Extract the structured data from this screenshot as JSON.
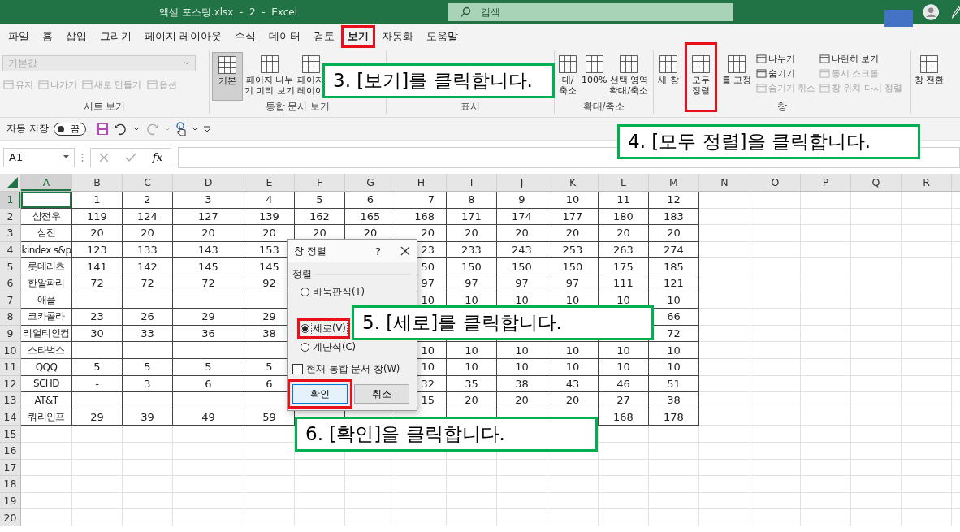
{
  "window": {
    "title": "엑셀 포스팅.xlsx  -  2  -  Excel"
  },
  "search": {
    "placeholder": "검색"
  },
  "tabs": [
    {
      "label": "파일",
      "selected": false
    },
    {
      "label": "홈",
      "selected": false
    },
    {
      "label": "삽입",
      "selected": false
    },
    {
      "label": "그리기",
      "selected": false
    },
    {
      "label": "페이지 레이아웃",
      "selected": false
    },
    {
      "label": "수식",
      "selected": false
    },
    {
      "label": "데이터",
      "selected": false
    },
    {
      "label": "검토",
      "selected": false
    },
    {
      "label": "보기",
      "selected": true
    },
    {
      "label": "자동화",
      "selected": false
    },
    {
      "label": "도움말",
      "selected": false
    }
  ],
  "ribbon": [
    {
      "label": "시트 보기",
      "items": [
        {
          "kind": "dropdown",
          "value": "기본값",
          "disabled": true
        },
        {
          "kind": "row",
          "items": [
            {
              "label": "유지",
              "disabled": true
            },
            {
              "label": "나가기",
              "disabled": true
            },
            {
              "label": "새로 만들기",
              "disabled": true
            },
            {
              "label": "옵션",
              "disabled": true
            }
          ]
        }
      ]
    },
    {
      "label": "통합 문서 보기",
      "items": [
        {
          "kind": "large",
          "label": "기본",
          "selected": true
        },
        {
          "kind": "large",
          "label": "페이지 나누\n기 미리 보기",
          "selected": false
        },
        {
          "kind": "large",
          "label": "페이지\n레이아",
          "selected": false
        }
      ]
    },
    {
      "label": "표시"
    },
    {
      "label": "확대/축소",
      "items": [
        {
          "kind": "large",
          "label": "대/\n축소",
          "selected": false
        },
        {
          "kind": "large",
          "label": "100%",
          "selected": false
        },
        {
          "kind": "large",
          "label": "선택 영역\n확대/축소",
          "selected": false
        }
      ]
    },
    {
      "label": "창",
      "items": [
        {
          "kind": "large",
          "label": "새 창",
          "selected": false
        },
        {
          "kind": "large",
          "label": "모두\n정렬",
          "selected": false
        },
        {
          "kind": "large",
          "label": "틀 고정",
          "selected": false
        },
        {
          "kind": "stack",
          "items": [
            {
              "label": "나누기",
              "disabled": false
            },
            {
              "label": "숨기기",
              "disabled": false
            },
            {
              "label": "숨기기 취소",
              "disabled": true
            }
          ]
        },
        {
          "kind": "stack",
          "items": [
            {
              "label": "나란히 보기",
              "disabled": false
            },
            {
              "label": "동시 스크롤",
              "disabled": true
            },
            {
              "label": "창 위치 다시 정렬",
              "disabled": true
            }
          ]
        }
      ]
    },
    {
      "items": [
        {
          "kind": "large",
          "label": "창 전환",
          "selected": false
        }
      ]
    }
  ],
  "quick_access": {
    "autosave_label": "자동 저장",
    "autosave": {
      "on": false,
      "label": "끔"
    }
  },
  "formula_bar": {
    "name_box": "A1",
    "function_label": "fx"
  },
  "sheet": {
    "columns": [
      {
        "label": "A",
        "selected": true
      },
      {
        "label": "B",
        "selected": false
      },
      {
        "label": "C",
        "selected": false
      },
      {
        "label": "D",
        "selected": false
      },
      {
        "label": "E",
        "selected": false
      },
      {
        "label": "F",
        "selected": false
      },
      {
        "label": "G",
        "selected": false
      },
      {
        "label": "H",
        "selected": false
      },
      {
        "label": "I",
        "selected": false
      },
      {
        "label": "J",
        "selected": false
      },
      {
        "label": "K",
        "selected": false
      },
      {
        "label": "L",
        "selected": false
      },
      {
        "label": "M",
        "selected": false
      },
      {
        "label": "N",
        "selected": false
      },
      {
        "label": "O",
        "selected": false
      },
      {
        "label": "P",
        "selected": false
      },
      {
        "label": "Q",
        "selected": false
      },
      {
        "label": "R",
        "selected": false
      }
    ],
    "rows": [
      {
        "number": "1",
        "selected": true,
        "cells": [
          null,
          "1",
          "2",
          "3",
          "4",
          "5",
          "6",
          "7",
          "8",
          "9",
          "10",
          "11",
          "12"
        ]
      },
      {
        "number": "2",
        "selected": false,
        "cells": [
          "삼전우",
          "119",
          "124",
          "127",
          "139",
          "162",
          "165",
          "168",
          "171",
          "174",
          "177",
          "180",
          "183"
        ]
      },
      {
        "number": "3",
        "selected": false,
        "cells": [
          "삼전",
          "20",
          "20",
          "20",
          "20",
          "20",
          "20",
          "20",
          "20",
          "20",
          "20",
          "20",
          "20"
        ]
      },
      {
        "number": "4",
        "selected": false,
        "cells": [
          "kindex s&p",
          "123",
          "133",
          "143",
          "153",
          null,
          null,
          "23",
          "233",
          "243",
          "253",
          "263",
          "274"
        ]
      },
      {
        "number": "5",
        "selected": false,
        "cells": [
          "롯데리츠",
          "141",
          "142",
          "145",
          "145",
          null,
          null,
          "50",
          "150",
          "150",
          "150",
          "175",
          "185"
        ]
      },
      {
        "number": "6",
        "selected": false,
        "cells": [
          "한알파리",
          "72",
          "72",
          "72",
          "92",
          null,
          null,
          "97",
          "97",
          "97",
          "97",
          "111",
          "121"
        ]
      },
      {
        "number": "7",
        "selected": false,
        "cells": [
          "애플",
          null,
          null,
          null,
          null,
          null,
          null,
          "10",
          "10",
          "10",
          "10",
          "10",
          "10"
        ]
      },
      {
        "number": "8",
        "selected": false,
        "cells": [
          "코카콜라",
          "23",
          "26",
          "29",
          "29",
          null,
          null,
          null,
          null,
          null,
          null,
          null,
          "66"
        ]
      },
      {
        "number": "9",
        "selected": false,
        "cells": [
          "리얼티인컴",
          "30",
          "33",
          "36",
          "38",
          null,
          null,
          null,
          null,
          null,
          null,
          null,
          "72"
        ]
      },
      {
        "number": "10",
        "selected": false,
        "cells": [
          "스타벅스",
          null,
          null,
          null,
          null,
          null,
          null,
          "10",
          "10",
          "10",
          "10",
          "10",
          "10"
        ]
      },
      {
        "number": "11",
        "selected": false,
        "cells": [
          "QQQ",
          "5",
          "5",
          "5",
          "5",
          null,
          null,
          "10",
          "10",
          "10",
          "10",
          "10",
          "10"
        ]
      },
      {
        "number": "12",
        "selected": false,
        "cells": [
          "SCHD",
          "-",
          "3",
          "6",
          "6",
          null,
          null,
          "32",
          "35",
          "38",
          "43",
          "46",
          "51"
        ]
      },
      {
        "number": "13",
        "selected": false,
        "cells": [
          "AT&T",
          null,
          null,
          null,
          null,
          null,
          null,
          "15",
          "20",
          "20",
          "20",
          "27",
          "38"
        ]
      },
      {
        "number": "14",
        "selected": false,
        "cells": [
          "쿼리인프",
          "29",
          "39",
          "49",
          "59",
          null,
          null,
          null,
          null,
          null,
          null,
          "168",
          "178"
        ]
      },
      {
        "number": "15",
        "selected": false
      },
      {
        "number": "16",
        "selected": false
      },
      {
        "number": "17",
        "selected": false
      },
      {
        "number": "18",
        "selected": false
      },
      {
        "number": "19",
        "selected": false
      },
      {
        "number": "20",
        "selected": false
      }
    ]
  },
  "dialog": {
    "title": "창 정렬",
    "help": "?",
    "group_label": "정렬",
    "options": [
      {
        "label": "바둑판식(T)",
        "selected": false
      },
      {
        "label": "세로(V)",
        "selected": true
      },
      {
        "label": "계단식(C)",
        "selected": false
      }
    ],
    "checkbox": {
      "label": "현재 통합 문서 창(W)",
      "checked": false
    },
    "buttons": [
      {
        "label": "확인",
        "default": true
      },
      {
        "label": "취소",
        "default": false
      }
    ]
  },
  "callouts": [
    {
      "text": "3. [보기]를 클릭합니다."
    },
    {
      "text": "4. [모두 정렬]을 클릭합니다."
    },
    {
      "text": "5. [세로]를 클릭합니다."
    },
    {
      "text": "6. [확인]을 클릭합니다."
    }
  ]
}
